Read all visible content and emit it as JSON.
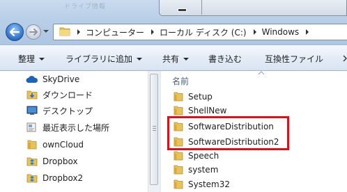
{
  "window": {
    "ghost_title": "ドライブ情報"
  },
  "address": {
    "crumbs": [
      "コンピューター",
      "ローカル ディスク (C:)",
      "Windows"
    ]
  },
  "toolbar": {
    "organize": "整理",
    "add_to_library": "ライブラリに追加",
    "share": "共有",
    "burn": "書き込む",
    "compat_files": "互換性ファイル"
  },
  "nav": {
    "items": [
      {
        "label": "SkyDrive",
        "icon": "cloud-icon"
      },
      {
        "label": "ダウンロード",
        "icon": "downloads-folder-icon"
      },
      {
        "label": "デスクトップ",
        "icon": "desktop-icon"
      },
      {
        "label": "最近表示した場所",
        "icon": "recent-places-icon"
      },
      {
        "label": "ownCloud",
        "icon": "folder-icon"
      },
      {
        "label": "Dropbox",
        "icon": "dropbox-icon"
      },
      {
        "label": "Dropbox2",
        "icon": "dropbox-icon"
      }
    ]
  },
  "content": {
    "column_name": "名前",
    "files": [
      {
        "label": "Setup",
        "icon": "folder-icon"
      },
      {
        "label": "ShellNew",
        "icon": "folder-icon"
      },
      {
        "label": "SoftwareDistribution",
        "icon": "folder-icon"
      },
      {
        "label": "SoftwareDistribution2",
        "icon": "folder-icon"
      },
      {
        "label": "Speech",
        "icon": "folder-icon"
      },
      {
        "label": "system",
        "icon": "folder-icon"
      },
      {
        "label": "System32",
        "icon": "folder-icon"
      }
    ]
  },
  "colors": {
    "highlight": "#e30d17",
    "folder": "#e8c25a",
    "accent": "#2c6ec3"
  }
}
